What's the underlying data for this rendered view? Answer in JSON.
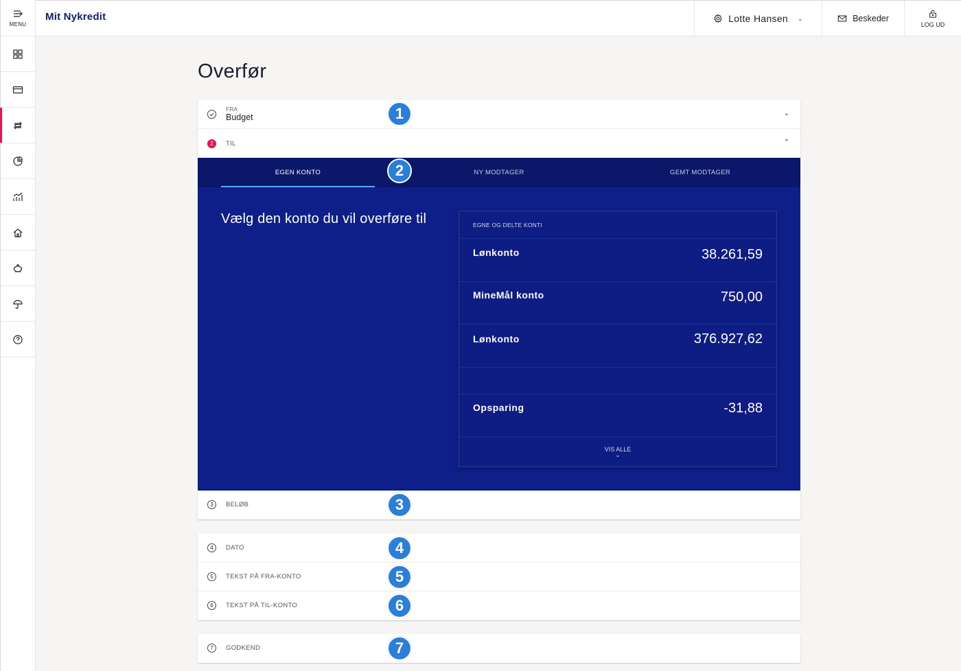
{
  "sidebar": {
    "menu_label": "MENU",
    "items": [
      {
        "icon": "dashboard-icon"
      },
      {
        "icon": "card-icon"
      },
      {
        "icon": "transfer-icon",
        "active": true
      },
      {
        "icon": "pie-chart-icon"
      },
      {
        "icon": "bar-chart-icon"
      },
      {
        "icon": "home-icon"
      },
      {
        "icon": "piggy-bank-icon"
      },
      {
        "icon": "umbrella-icon"
      },
      {
        "icon": "help-icon"
      }
    ]
  },
  "header": {
    "logo_mit": "Mit",
    "logo_brand": "Nykredit",
    "user_name": "Lotte Hansen",
    "messages_label": "Beskeder",
    "logout_label": "LOG UD"
  },
  "page": {
    "title": "Overfør"
  },
  "steps": {
    "fra_label": "FRA",
    "fra_value": "Budget",
    "til_number": "2",
    "til_label": "TIL",
    "belob_number": "3",
    "belob_label": "BELØB",
    "dato_number": "4",
    "dato_label": "DATO",
    "tekst_fra_number": "5",
    "tekst_fra_label": "TEKST PÅ FRA-KONTO",
    "tekst_til_number": "6",
    "tekst_til_label": "TEKST PÅ TIL-KONTO",
    "godkend_number": "7",
    "godkend_label": "GODKEND"
  },
  "tabs": [
    {
      "label": "EGEN KONTO",
      "active": true
    },
    {
      "label": "NY MODTAGER"
    },
    {
      "label": "GEMT MODTAGER"
    }
  ],
  "panel": {
    "heading": "Vælg den konto du vil overføre til",
    "accounts_header": "EGNE OG DELTE KONTI",
    "accounts": [
      {
        "name": "Lønkonto",
        "amount": "38.261,59"
      },
      {
        "name": "MineMål konto",
        "amount": "750,00"
      },
      {
        "name": "Lønkonto",
        "amount": "376.927,62"
      },
      {
        "name": "",
        "amount": ""
      },
      {
        "name": "Opsparing",
        "amount": "-31,88"
      }
    ],
    "show_all_label": "VIS ALLE"
  },
  "badges": [
    "1",
    "2",
    "3",
    "4",
    "5",
    "6",
    "7"
  ]
}
